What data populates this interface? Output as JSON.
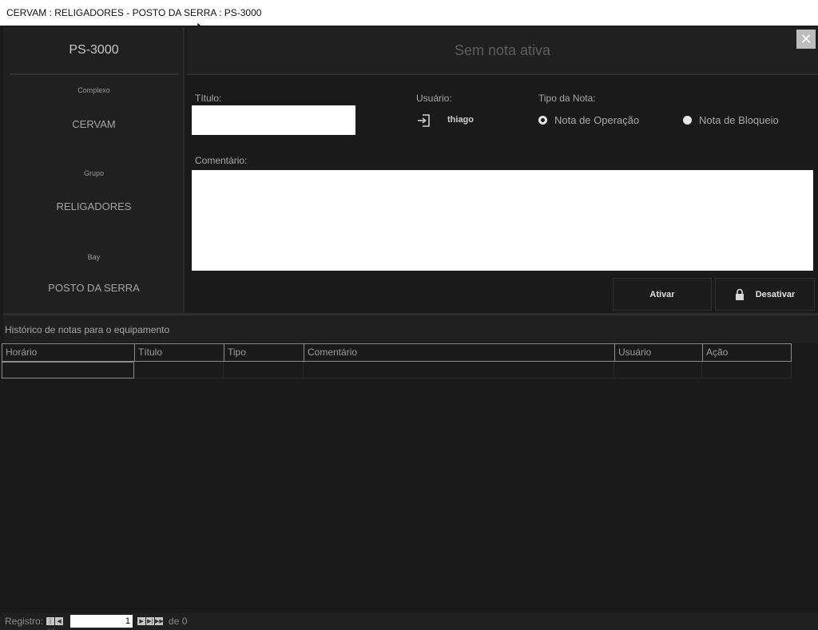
{
  "window": {
    "title": "CERVAM : RELIGADORES - POSTO DA SERRA : PS-3000"
  },
  "equipment": {
    "name": "PS-3000",
    "fields": [
      {
        "label": "Complexo",
        "value": "CERVAM"
      },
      {
        "label": "Grupo",
        "value": "RELIGADORES"
      },
      {
        "label": "Bay",
        "value": "POSTO DA SERRA"
      }
    ]
  },
  "header": {
    "status": "Sem nota ativa",
    "close_glyph": "✕"
  },
  "form": {
    "titulo_label": "Título:",
    "titulo_value": "",
    "usuario_label": "Usuário:",
    "usuario_value": "thiago",
    "usuario_icon": "login-icon",
    "tipo_label": "Tipo da Nota:",
    "tipo_options": [
      {
        "label": "Nota de Operação",
        "selected": true
      },
      {
        "label": "Nota de Bloqueio",
        "selected": false
      }
    ],
    "comentario_label": "Comentário:",
    "comentario_value": ""
  },
  "buttons": {
    "ativar": "Ativar",
    "desativar": "Desativar",
    "desativar_icon": "lock-icon"
  },
  "history": {
    "title": "Histórico de notas para o equipamento",
    "columns": [
      "Horário",
      "Título",
      "Tipo",
      "Comentário",
      "Usuário",
      "Ação"
    ],
    "rows": []
  },
  "pager": {
    "label": "Registro:",
    "first": "|◀◀",
    "prev": "◀",
    "current": "1",
    "next": "▶",
    "next_page": "▶|",
    "last": "▶▶",
    "of_text": "de 0"
  },
  "colors": {
    "background": "#1a1a1a",
    "panel": "#202020",
    "accent_text": "#a8a8a8"
  }
}
